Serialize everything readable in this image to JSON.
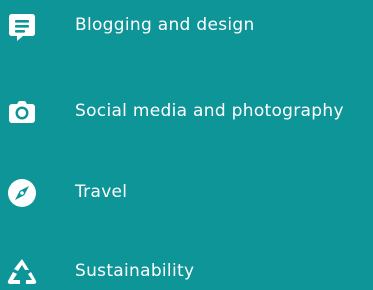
{
  "theme": {
    "background": "#0e9597",
    "foreground": "#ffffff"
  },
  "interests": [
    {
      "label": "Blogging and design",
      "icon": "chat-bubble-icon"
    },
    {
      "label": "Social media and photography",
      "icon": "camera-icon"
    },
    {
      "label": "Travel",
      "icon": "compass-icon"
    },
    {
      "label": "Sustainability",
      "icon": "recycle-icon"
    }
  ]
}
